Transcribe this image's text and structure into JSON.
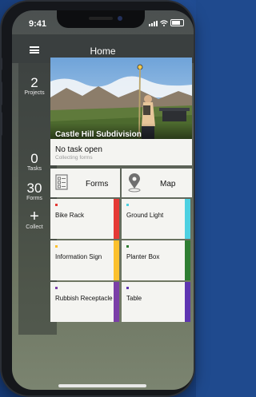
{
  "status": {
    "time": "9:41"
  },
  "nav": {
    "title": "Home"
  },
  "stats": [
    {
      "value": "2",
      "label": "Projects"
    },
    {
      "value": "0",
      "label": "Tasks"
    },
    {
      "value": "30",
      "label": "Forms"
    },
    {
      "value": "+",
      "label": "Collect"
    }
  ],
  "project": {
    "name": "Castle Hill Subdivision"
  },
  "task": {
    "title": "No task open",
    "subtitle": "Collecting forms"
  },
  "actions": {
    "forms_label": "Forms",
    "map_label": "Map"
  },
  "forms": [
    {
      "name": "Bike Rack",
      "color": "#e53935"
    },
    {
      "name": "Ground Light",
      "color": "#4dd0e1"
    },
    {
      "name": "Information Sign",
      "color": "#fbc02d"
    },
    {
      "name": "Planter Box",
      "color": "#2e7d32"
    },
    {
      "name": "Rubbish Receptacle",
      "color": "#7b3fa8"
    },
    {
      "name": "Table",
      "color": "#5e35b1"
    }
  ],
  "colors": {
    "background": "#1f4a8e",
    "navbar": "#3a3f3f",
    "tile": "#f4f4f1"
  }
}
